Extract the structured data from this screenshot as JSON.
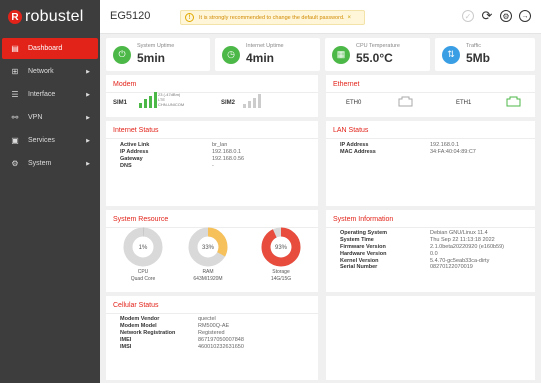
{
  "header": {
    "logo_text": "robustel",
    "model": "EG5120",
    "warning": "It is strongly recommended to change the default password.",
    "warning_close": "×",
    "icons": [
      "check-circle-icon",
      "refresh-icon",
      "settings-icon",
      "logout-icon"
    ]
  },
  "sidebar": {
    "items": [
      {
        "label": "Dashboard",
        "icon": "dashboard-icon",
        "active": true
      },
      {
        "label": "Network",
        "icon": "network-icon",
        "arrow": "▶"
      },
      {
        "label": "Interface",
        "icon": "interface-icon",
        "arrow": "▶"
      },
      {
        "label": "VPN",
        "icon": "vpn-icon",
        "arrow": "▶"
      },
      {
        "label": "Services",
        "icon": "services-icon",
        "arrow": "▶"
      },
      {
        "label": "System",
        "icon": "system-icon",
        "arrow": "▶"
      }
    ]
  },
  "metrics": {
    "uptime": {
      "label": "System Uptime",
      "value": "5min",
      "color": "#4cb848"
    },
    "internet": {
      "label": "Internet Uptime",
      "value": "4min",
      "color": "#4cb848"
    },
    "cpu_temp": {
      "label": "CPU Temperature",
      "value": "55.0°C",
      "color": "#4cb848"
    },
    "traffic": {
      "label": "Traffic",
      "value": "5Mb",
      "color": "#3a9ee4"
    }
  },
  "modem": {
    "title": "Modem",
    "sim1": {
      "label": "SIM1",
      "info": [
        "23 (-47dBm)",
        "LTE",
        "CHN-UNICOM"
      ],
      "level": 4
    },
    "sim2": {
      "label": "SIM2",
      "level": 0
    }
  },
  "ethernet": {
    "title": "Ethernet",
    "ports": [
      {
        "label": "ETH0",
        "connected": false
      },
      {
        "label": "ETH1",
        "connected": true
      }
    ]
  },
  "internet_status": {
    "title": "Internet Status",
    "rows": [
      {
        "k": "Active Link",
        "v": "br_lan"
      },
      {
        "k": "IP Address",
        "v": "192.168.0.1"
      },
      {
        "k": "Gateway",
        "v": "192.168.0.56"
      },
      {
        "k": "DNS",
        "v": "-"
      }
    ]
  },
  "lan_status": {
    "title": "LAN Status",
    "rows": [
      {
        "k": "IP Address",
        "v": "192.168.0.1"
      },
      {
        "k": "MAC Address",
        "v": "34:FA:40:04:89:C7"
      }
    ]
  },
  "system_resource": {
    "title": "System Resource",
    "gauges": [
      {
        "pct": "1%",
        "value": 0.01,
        "color": "#c8c8c8",
        "caption": [
          "CPU",
          "Quad Core"
        ]
      },
      {
        "pct": "33%",
        "value": 0.33,
        "color": "#f6c15b",
        "caption": [
          "RAM",
          "643M/1920M"
        ]
      },
      {
        "pct": "93%",
        "value": 0.93,
        "color": "#e84c3d",
        "caption": [
          "Storage",
          "14G/15G"
        ]
      }
    ]
  },
  "system_information": {
    "title": "System Information",
    "rows": [
      {
        "k": "Operating System",
        "v": "Debian GNU/Linux 11.4"
      },
      {
        "k": "System Time",
        "v": "Thu Sep 22 11:13:18 2022"
      },
      {
        "k": "Firmware Version",
        "v": "2.1.0beta20220920 (e160b59)"
      },
      {
        "k": "Hardware Version",
        "v": "0.0"
      },
      {
        "k": "Kernel Version",
        "v": "5.4.70-gc5eab33ca-dirty"
      },
      {
        "k": "Serial Number",
        "v": "08270122070019"
      }
    ]
  },
  "cellular_status": {
    "title": "Cellular Status",
    "rows": [
      {
        "k": "Modem Vendor",
        "v": "quectel"
      },
      {
        "k": "Modem Model",
        "v": "RM500Q-AE"
      },
      {
        "k": "Network Registration",
        "v": "Registered"
      },
      {
        "k": "IMEI",
        "v": "867197050007848"
      },
      {
        "k": "IMSI",
        "v": "460010232631650"
      }
    ]
  }
}
